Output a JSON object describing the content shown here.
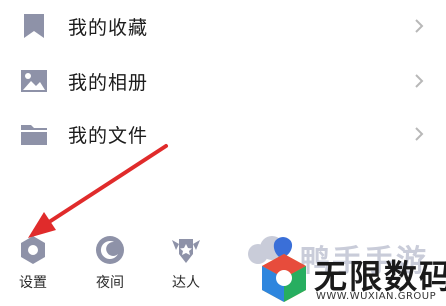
{
  "menu": [
    {
      "label": "我的收藏",
      "icon": "bookmark-icon"
    },
    {
      "label": "我的相册",
      "icon": "image-icon"
    },
    {
      "label": "我的文件",
      "icon": "folder-icon"
    }
  ],
  "bottom_bar": [
    {
      "label": "设置",
      "icon": "settings-hexagon-icon"
    },
    {
      "label": "夜间",
      "icon": "moon-icon"
    },
    {
      "label": "达人",
      "icon": "expert-badge-icon"
    }
  ],
  "overlay_text": "鸭手手游",
  "watermark": {
    "name": "无限数码",
    "sub": "WWW.WUXIAN.GROUP"
  },
  "colors": {
    "icon": "#8e92a8",
    "arrow": "#e02b2b",
    "chevron": "#b8b8b8"
  }
}
